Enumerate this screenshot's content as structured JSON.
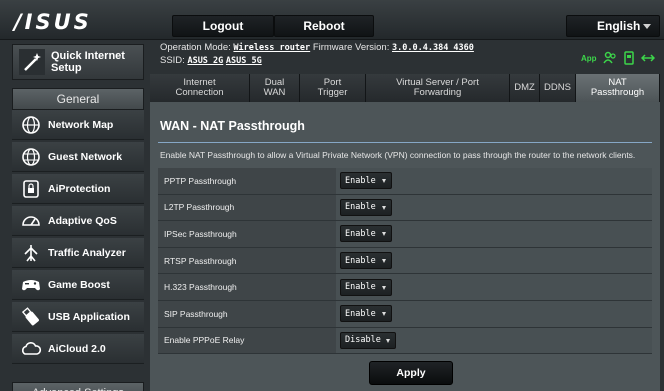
{
  "header": {
    "logo": "/ISUS",
    "logout_label": "Logout",
    "reboot_label": "Reboot",
    "language": "English"
  },
  "sidebar": {
    "quick_setup": {
      "line1": "Quick Internet",
      "line2": "Setup",
      "icon": "wand-icon"
    },
    "general_heading": "General",
    "items": [
      {
        "label": "Network Map",
        "icon": "globe-network-icon"
      },
      {
        "label": "Guest Network",
        "icon": "globe-guest-icon"
      },
      {
        "label": "AiProtection",
        "icon": "lock-shield-icon"
      },
      {
        "label": "Adaptive QoS",
        "icon": "speedometer-icon"
      },
      {
        "label": "Traffic Analyzer",
        "icon": "traffic-icon"
      },
      {
        "label": "Game Boost",
        "icon": "gamepad-icon"
      },
      {
        "label": "USB Application",
        "icon": "usb-icon"
      },
      {
        "label": "AiCloud 2.0",
        "icon": "cloud-icon"
      }
    ],
    "advanced_heading": "Advanced Settings"
  },
  "status": {
    "op_mode_label": "Operation Mode:",
    "op_mode_value": "Wireless router",
    "firmware_label": "Firmware Version:",
    "firmware_value": "3.0.0.4.384_4360",
    "ssid_label": "SSID:",
    "ssid_2g": "ASUS_2G",
    "ssid_5g": "ASUS_5G",
    "app_label": "App",
    "accent_green": "#3cd64a"
  },
  "tabs": [
    {
      "line1": "Internet",
      "line2": "Connection"
    },
    {
      "line1": "Dual",
      "line2": "WAN"
    },
    {
      "line1": "Port",
      "line2": "Trigger"
    },
    {
      "line1": "Virtual Server / Port",
      "line2": "Forwarding"
    },
    {
      "line1": "DMZ",
      "line2": ""
    },
    {
      "line1": "DDNS",
      "line2": ""
    },
    {
      "line1": "NAT",
      "line2": "Passthrough"
    }
  ],
  "content": {
    "title": "WAN - NAT Passthrough",
    "description": "Enable NAT Passthrough to allow a Virtual Private Network (VPN) connection to pass through the router to the network clients.",
    "rows": [
      {
        "label": "PPTP Passthrough",
        "value": "Enable"
      },
      {
        "label": "L2TP Passthrough",
        "value": "Enable"
      },
      {
        "label": "IPSec Passthrough",
        "value": "Enable"
      },
      {
        "label": "RTSP Passthrough",
        "value": "Enable"
      },
      {
        "label": "H.323 Passthrough",
        "value": "Enable"
      },
      {
        "label": "SIP Passthrough",
        "value": "Enable"
      },
      {
        "label": "Enable PPPoE Relay",
        "value": "Disable"
      }
    ],
    "apply_label": "Apply"
  }
}
